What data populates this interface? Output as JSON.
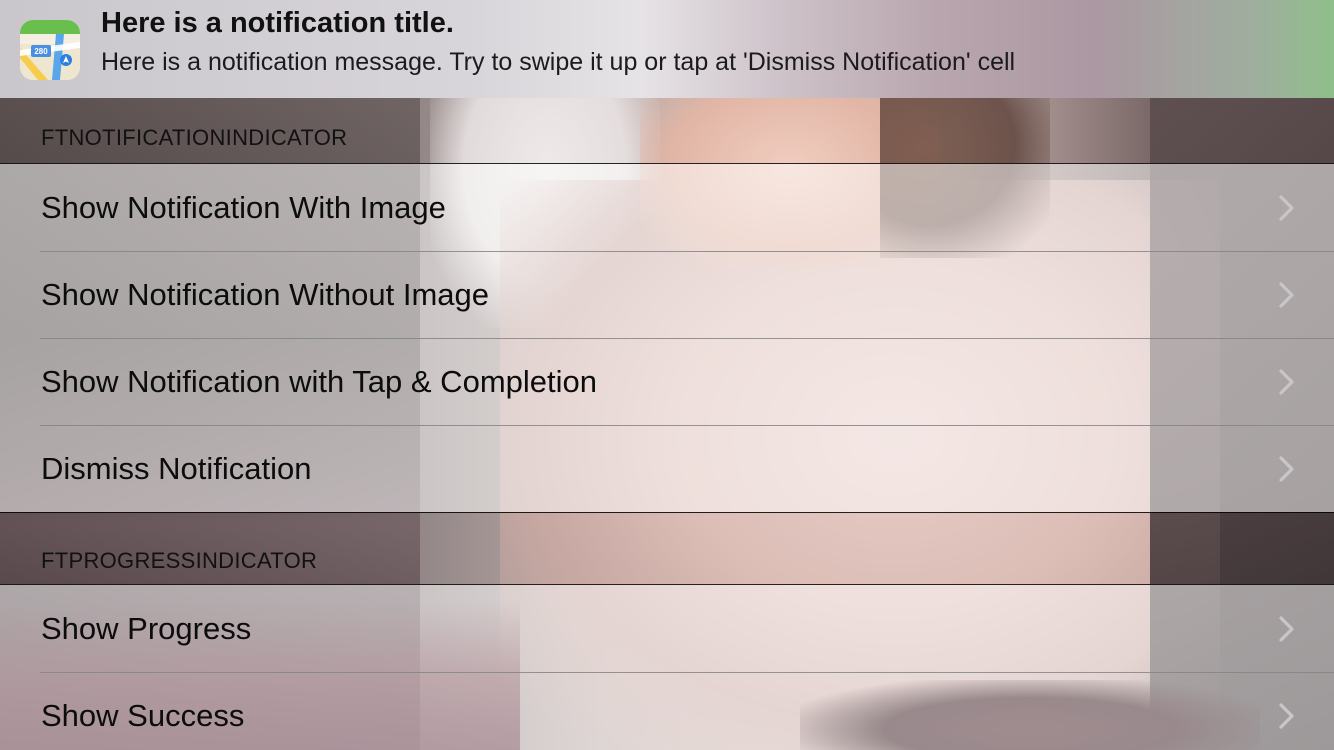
{
  "notification": {
    "app_icon": "maps-app-icon",
    "map_badge_text": "280",
    "title": "Here is a notification title.",
    "message": "Here is a notification message. Try to swipe it up or tap at 'Dismiss Notification' cell"
  },
  "sections": [
    {
      "header": "FTNOTIFICATIONINDICATOR",
      "rows": [
        {
          "label": "Show Notification With Image"
        },
        {
          "label": "Show Notification Without Image"
        },
        {
          "label": "Show Notification with Tap & Completion"
        },
        {
          "label": "Dismiss Notification"
        }
      ]
    },
    {
      "header": "FTPROGRESSINDICATOR",
      "rows": [
        {
          "label": "Show Progress"
        },
        {
          "label": "Show Success"
        }
      ]
    }
  ],
  "icons": {
    "row_accessory": "chevron-right-icon"
  },
  "colors": {
    "separator": "#000000",
    "cell_background": "rgba(255,255,255,0.52)",
    "chevron": "#c7c7cc"
  }
}
